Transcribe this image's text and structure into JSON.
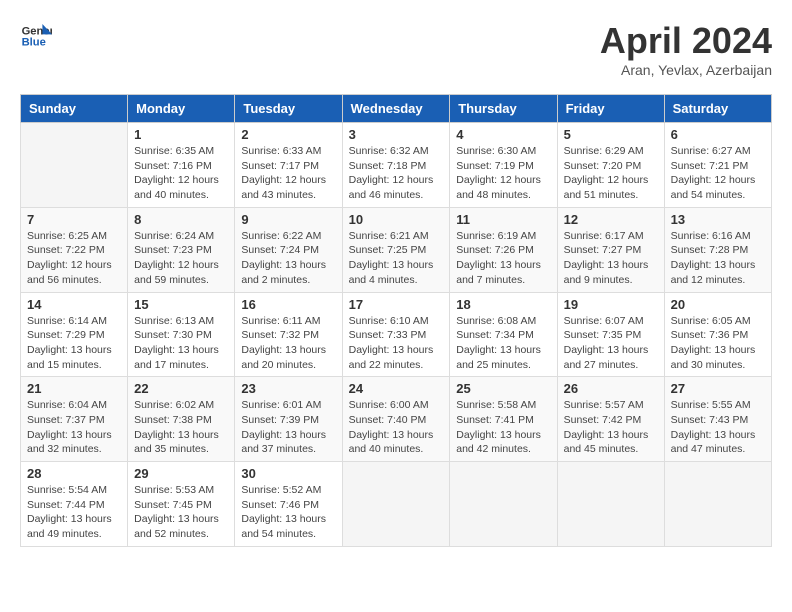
{
  "header": {
    "logo_line1": "General",
    "logo_line2": "Blue",
    "month": "April 2024",
    "location": "Aran, Yevlax, Azerbaijan"
  },
  "weekdays": [
    "Sunday",
    "Monday",
    "Tuesday",
    "Wednesday",
    "Thursday",
    "Friday",
    "Saturday"
  ],
  "weeks": [
    [
      {
        "day": "",
        "sunrise": "",
        "sunset": "",
        "daylight": ""
      },
      {
        "day": "1",
        "sunrise": "Sunrise: 6:35 AM",
        "sunset": "Sunset: 7:16 PM",
        "daylight": "Daylight: 12 hours and 40 minutes."
      },
      {
        "day": "2",
        "sunrise": "Sunrise: 6:33 AM",
        "sunset": "Sunset: 7:17 PM",
        "daylight": "Daylight: 12 hours and 43 minutes."
      },
      {
        "day": "3",
        "sunrise": "Sunrise: 6:32 AM",
        "sunset": "Sunset: 7:18 PM",
        "daylight": "Daylight: 12 hours and 46 minutes."
      },
      {
        "day": "4",
        "sunrise": "Sunrise: 6:30 AM",
        "sunset": "Sunset: 7:19 PM",
        "daylight": "Daylight: 12 hours and 48 minutes."
      },
      {
        "day": "5",
        "sunrise": "Sunrise: 6:29 AM",
        "sunset": "Sunset: 7:20 PM",
        "daylight": "Daylight: 12 hours and 51 minutes."
      },
      {
        "day": "6",
        "sunrise": "Sunrise: 6:27 AM",
        "sunset": "Sunset: 7:21 PM",
        "daylight": "Daylight: 12 hours and 54 minutes."
      }
    ],
    [
      {
        "day": "7",
        "sunrise": "Sunrise: 6:25 AM",
        "sunset": "Sunset: 7:22 PM",
        "daylight": "Daylight: 12 hours and 56 minutes."
      },
      {
        "day": "8",
        "sunrise": "Sunrise: 6:24 AM",
        "sunset": "Sunset: 7:23 PM",
        "daylight": "Daylight: 12 hours and 59 minutes."
      },
      {
        "day": "9",
        "sunrise": "Sunrise: 6:22 AM",
        "sunset": "Sunset: 7:24 PM",
        "daylight": "Daylight: 13 hours and 2 minutes."
      },
      {
        "day": "10",
        "sunrise": "Sunrise: 6:21 AM",
        "sunset": "Sunset: 7:25 PM",
        "daylight": "Daylight: 13 hours and 4 minutes."
      },
      {
        "day": "11",
        "sunrise": "Sunrise: 6:19 AM",
        "sunset": "Sunset: 7:26 PM",
        "daylight": "Daylight: 13 hours and 7 minutes."
      },
      {
        "day": "12",
        "sunrise": "Sunrise: 6:17 AM",
        "sunset": "Sunset: 7:27 PM",
        "daylight": "Daylight: 13 hours and 9 minutes."
      },
      {
        "day": "13",
        "sunrise": "Sunrise: 6:16 AM",
        "sunset": "Sunset: 7:28 PM",
        "daylight": "Daylight: 13 hours and 12 minutes."
      }
    ],
    [
      {
        "day": "14",
        "sunrise": "Sunrise: 6:14 AM",
        "sunset": "Sunset: 7:29 PM",
        "daylight": "Daylight: 13 hours and 15 minutes."
      },
      {
        "day": "15",
        "sunrise": "Sunrise: 6:13 AM",
        "sunset": "Sunset: 7:30 PM",
        "daylight": "Daylight: 13 hours and 17 minutes."
      },
      {
        "day": "16",
        "sunrise": "Sunrise: 6:11 AM",
        "sunset": "Sunset: 7:32 PM",
        "daylight": "Daylight: 13 hours and 20 minutes."
      },
      {
        "day": "17",
        "sunrise": "Sunrise: 6:10 AM",
        "sunset": "Sunset: 7:33 PM",
        "daylight": "Daylight: 13 hours and 22 minutes."
      },
      {
        "day": "18",
        "sunrise": "Sunrise: 6:08 AM",
        "sunset": "Sunset: 7:34 PM",
        "daylight": "Daylight: 13 hours and 25 minutes."
      },
      {
        "day": "19",
        "sunrise": "Sunrise: 6:07 AM",
        "sunset": "Sunset: 7:35 PM",
        "daylight": "Daylight: 13 hours and 27 minutes."
      },
      {
        "day": "20",
        "sunrise": "Sunrise: 6:05 AM",
        "sunset": "Sunset: 7:36 PM",
        "daylight": "Daylight: 13 hours and 30 minutes."
      }
    ],
    [
      {
        "day": "21",
        "sunrise": "Sunrise: 6:04 AM",
        "sunset": "Sunset: 7:37 PM",
        "daylight": "Daylight: 13 hours and 32 minutes."
      },
      {
        "day": "22",
        "sunrise": "Sunrise: 6:02 AM",
        "sunset": "Sunset: 7:38 PM",
        "daylight": "Daylight: 13 hours and 35 minutes."
      },
      {
        "day": "23",
        "sunrise": "Sunrise: 6:01 AM",
        "sunset": "Sunset: 7:39 PM",
        "daylight": "Daylight: 13 hours and 37 minutes."
      },
      {
        "day": "24",
        "sunrise": "Sunrise: 6:00 AM",
        "sunset": "Sunset: 7:40 PM",
        "daylight": "Daylight: 13 hours and 40 minutes."
      },
      {
        "day": "25",
        "sunrise": "Sunrise: 5:58 AM",
        "sunset": "Sunset: 7:41 PM",
        "daylight": "Daylight: 13 hours and 42 minutes."
      },
      {
        "day": "26",
        "sunrise": "Sunrise: 5:57 AM",
        "sunset": "Sunset: 7:42 PM",
        "daylight": "Daylight: 13 hours and 45 minutes."
      },
      {
        "day": "27",
        "sunrise": "Sunrise: 5:55 AM",
        "sunset": "Sunset: 7:43 PM",
        "daylight": "Daylight: 13 hours and 47 minutes."
      }
    ],
    [
      {
        "day": "28",
        "sunrise": "Sunrise: 5:54 AM",
        "sunset": "Sunset: 7:44 PM",
        "daylight": "Daylight: 13 hours and 49 minutes."
      },
      {
        "day": "29",
        "sunrise": "Sunrise: 5:53 AM",
        "sunset": "Sunset: 7:45 PM",
        "daylight": "Daylight: 13 hours and 52 minutes."
      },
      {
        "day": "30",
        "sunrise": "Sunrise: 5:52 AM",
        "sunset": "Sunset: 7:46 PM",
        "daylight": "Daylight: 13 hours and 54 minutes."
      },
      {
        "day": "",
        "sunrise": "",
        "sunset": "",
        "daylight": ""
      },
      {
        "day": "",
        "sunrise": "",
        "sunset": "",
        "daylight": ""
      },
      {
        "day": "",
        "sunrise": "",
        "sunset": "",
        "daylight": ""
      },
      {
        "day": "",
        "sunrise": "",
        "sunset": "",
        "daylight": ""
      }
    ]
  ]
}
